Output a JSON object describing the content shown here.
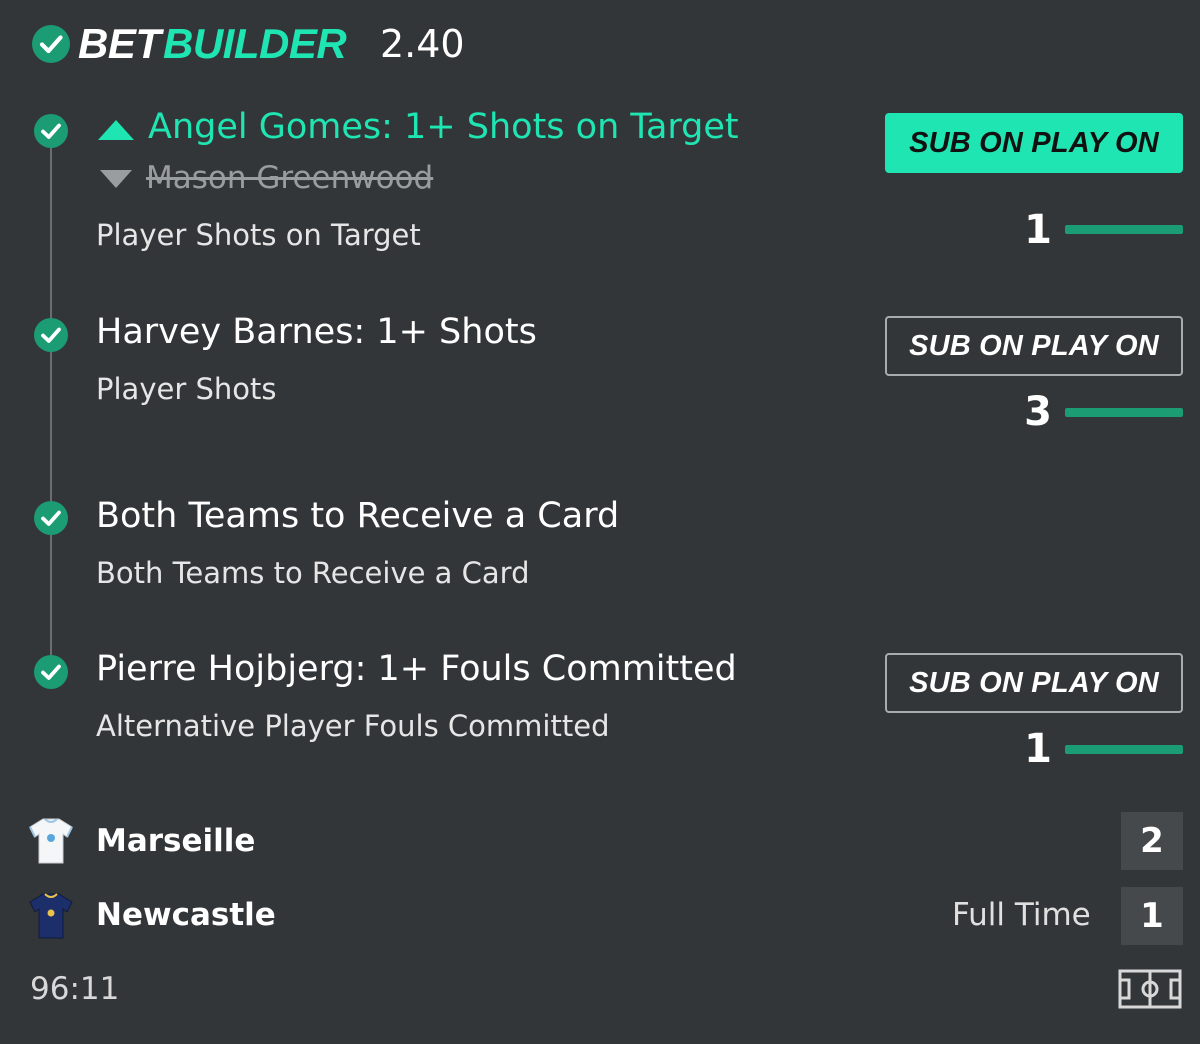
{
  "header": {
    "word1": "BET",
    "word2": "BUILDER",
    "odds": "2.40",
    "icon": "check-circle-icon"
  },
  "colors": {
    "accent": "#1fe5b2",
    "check": "#1b9c72",
    "background": "#333638"
  },
  "legs": [
    {
      "title": "Angel Gomes: 1+ Shots on Target",
      "replaced": "Mason Greenwood",
      "market": "Player Shots on Target",
      "button": "SUB ON PLAY ON",
      "button_active": true,
      "stat": "1"
    },
    {
      "title": "Harvey Barnes: 1+ Shots",
      "market": "Player Shots",
      "button": "SUB ON PLAY ON",
      "button_active": false,
      "stat": "3"
    },
    {
      "title": "Both Teams to Receive a Card",
      "market": "Both Teams to Receive a Card"
    },
    {
      "title": "Pierre Hojbjerg: 1+ Fouls Committed",
      "market": "Alternative Player Fouls Committed",
      "button": "SUB ON PLAY ON",
      "button_active": false,
      "stat": "1"
    }
  ],
  "match": {
    "home": {
      "name": "Marseille",
      "score": "2",
      "icon": "white-shirt-icon"
    },
    "away": {
      "name": "Newcastle",
      "score": "1",
      "icon": "navy-shirt-icon"
    },
    "status": "Full Time",
    "clock": "96:11"
  }
}
